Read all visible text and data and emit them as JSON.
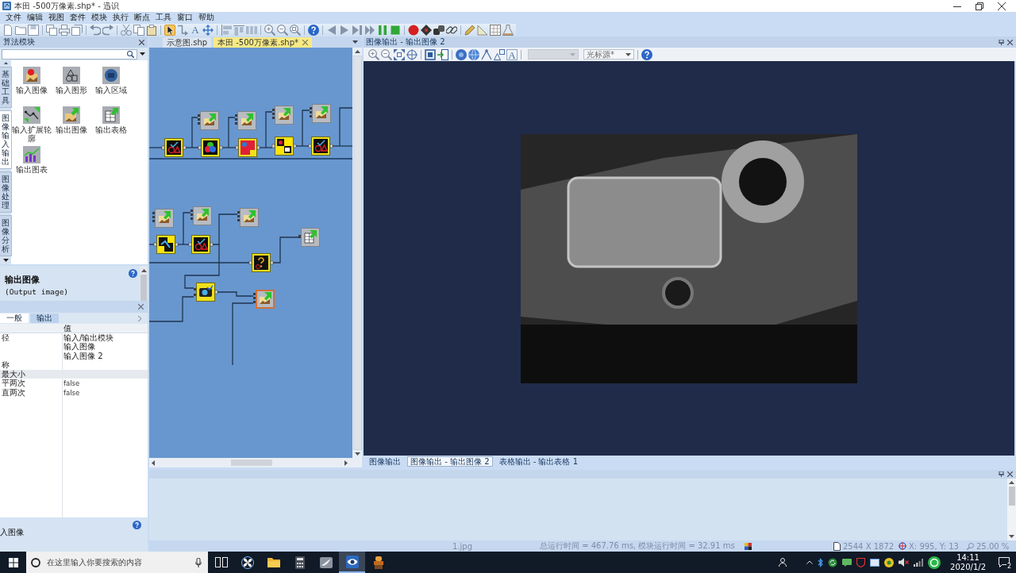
{
  "window": {
    "title": "本田 -500万像素.shp* - 迅识"
  },
  "menu": [
    "文件",
    "编辑",
    "视图",
    "套件",
    "模块",
    "执行",
    "断点",
    "工具",
    "窗口",
    "帮助"
  ],
  "toolbar": [
    {
      "kind": "new"
    },
    {
      "kind": "open"
    },
    {
      "kind": "save"
    },
    {
      "kind": "separator"
    },
    {
      "kind": "save-all"
    },
    {
      "kind": "print"
    },
    {
      "kind": "duplicate"
    },
    {
      "kind": "separator"
    },
    {
      "kind": "undo"
    },
    {
      "kind": "redo"
    },
    {
      "kind": "separator"
    },
    {
      "kind": "cut"
    },
    {
      "kind": "copy"
    },
    {
      "kind": "paste"
    },
    {
      "kind": "separator"
    },
    {
      "kind": "pointer",
      "selected": true
    },
    {
      "kind": "connect",
      "selected": false
    },
    {
      "kind": "text",
      "label": "A",
      "selected": false
    },
    {
      "kind": "move",
      "selected": false
    },
    {
      "kind": "separator"
    },
    {
      "kind": "align-left"
    },
    {
      "kind": "align-top"
    },
    {
      "kind": "distribute"
    },
    {
      "kind": "separator"
    },
    {
      "kind": "zoom-in"
    },
    {
      "kind": "zoom-out"
    },
    {
      "kind": "zoom-fit"
    },
    {
      "kind": "separator"
    },
    {
      "kind": "help"
    },
    {
      "kind": "separator"
    },
    {
      "kind": "step-back"
    },
    {
      "kind": "run"
    },
    {
      "kind": "run-to-end"
    },
    {
      "kind": "fast-forward"
    },
    {
      "kind": "pause"
    },
    {
      "kind": "stop"
    },
    {
      "kind": "separator"
    },
    {
      "kind": "breakpoint"
    },
    {
      "kind": "chip"
    },
    {
      "kind": "dice"
    },
    {
      "kind": "link"
    },
    {
      "kind": "separator"
    },
    {
      "kind": "pencil"
    },
    {
      "kind": "ruler"
    },
    {
      "kind": "grid"
    },
    {
      "kind": "flask"
    }
  ],
  "toolbox": {
    "title": "算法模块",
    "tabs": [
      {
        "label": "基础工具",
        "selected": false
      },
      {
        "label": "图像输入输出",
        "selected": true
      },
      {
        "label": "图像处理",
        "selected": false
      },
      {
        "label": "图像分析",
        "selected": false
      }
    ],
    "items": [
      {
        "label": "输入图像",
        "kind": "image"
      },
      {
        "label": "输入图形",
        "kind": "shape"
      },
      {
        "label": "输入区域",
        "kind": "region"
      },
      {
        "label": "输入扩展轮廓",
        "kind": "path"
      },
      {
        "label": "输出图像",
        "kind": "output-image"
      },
      {
        "label": "输出表格",
        "kind": "output-table"
      },
      {
        "label": "输出图表",
        "kind": "output-chart"
      }
    ]
  },
  "help": {
    "title": "输出图像",
    "subtitle": "(Output image)"
  },
  "properties": {
    "tabs": [
      {
        "label": "一般",
        "selected": true
      },
      {
        "label": "输出",
        "selected": false
      }
    ],
    "value_header": "值",
    "rows": [
      {
        "kind": "item",
        "name": "径",
        "value": "输入/输出模块"
      },
      {
        "kind": "item",
        "value": "输入图像"
      },
      {
        "kind": "item",
        "value": "输入图像 2"
      },
      {
        "kind": "item",
        "name": "称"
      },
      {
        "kind": "group",
        "name": "最大小"
      },
      {
        "kind": "item",
        "name": "平两次",
        "value": "false"
      },
      {
        "kind": "item",
        "name": "直两次",
        "value": "false"
      }
    ]
  },
  "description": {
    "text": "入图像"
  },
  "diagram": {
    "tabs": [
      {
        "label": "示意图.shp",
        "selected": false
      },
      {
        "label": "本田 -500万像素.shp*",
        "selected": true
      }
    ]
  },
  "image_view": {
    "title": "图像输出 - 输出图像 2",
    "toolbar": [
      {
        "kind": "zoom-in"
      },
      {
        "kind": "zoom-out"
      },
      {
        "kind": "fit"
      },
      {
        "kind": "target"
      },
      {
        "kind": "separator"
      },
      {
        "kind": "frame"
      },
      {
        "kind": "import"
      },
      {
        "kind": "separator"
      },
      {
        "kind": "disc"
      },
      {
        "kind": "globe"
      },
      {
        "kind": "angle"
      },
      {
        "kind": "shapes"
      },
      {
        "kind": "text",
        "label": "A"
      },
      {
        "kind": "separator"
      },
      {
        "kind": "dropdown",
        "disabled": true
      },
      {
        "kind": "dropdown",
        "disabled": false,
        "value": "光标源*"
      },
      {
        "kind": "separator"
      },
      {
        "kind": "help"
      }
    ]
  },
  "image_tabs": [
    {
      "label": "图像输出",
      "selected": false
    },
    {
      "label": "图像输出 - 输出图像 2",
      "selected": true
    },
    {
      "label": "表格输出 - 输出表格 1",
      "selected": false
    }
  ],
  "status_bar": {
    "file": "1.jpg",
    "timing": "总运行时间 = 467.76 ms, 模块运行时间 = 32.91 ms",
    "size": "2544 X 1872",
    "position": "X: 995, Y: 13",
    "zoom": "25.00 %"
  },
  "taskbar": {
    "search": {
      "placeholder": "在这里输入你要搜索的内容"
    },
    "apps": [
      {
        "kind": "task-view",
        "selected": false
      },
      {
        "kind": "pinwheel",
        "selected": false
      },
      {
        "kind": "folder",
        "selected": false
      },
      {
        "kind": "calculator",
        "selected": false
      },
      {
        "kind": "bird",
        "selected": false
      },
      {
        "kind": "eye",
        "selected": true
      },
      {
        "kind": "figure",
        "selected": false
      }
    ],
    "time": "14:11",
    "date": "2020/1/2",
    "notification_count": "2"
  }
}
